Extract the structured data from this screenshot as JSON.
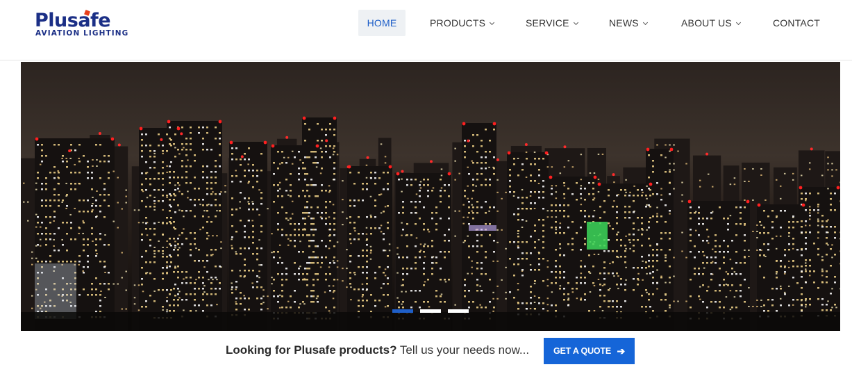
{
  "logo": {
    "name": "Plusafe",
    "tagline": "AVIATION LIGHTING"
  },
  "nav": {
    "items": [
      {
        "label": "HOME",
        "active": true,
        "dropdown": false
      },
      {
        "label": "PRODUCTS",
        "active": false,
        "dropdown": true
      },
      {
        "label": "SERVICE",
        "active": false,
        "dropdown": true
      },
      {
        "label": "NEWS",
        "active": false,
        "dropdown": true
      },
      {
        "label": "ABOUT US",
        "active": false,
        "dropdown": true
      },
      {
        "label": "CONTACT",
        "active": false,
        "dropdown": false
      }
    ]
  },
  "hero": {
    "image_description_icon": "city-night-skyline",
    "slides_count": 3,
    "active_slide": 1
  },
  "cta": {
    "bold": "Looking for Plusafe products?",
    "text": " Tell us your needs now...",
    "button_label": "GET A QUOTE",
    "button_icon": "arrow-right-icon"
  },
  "colors": {
    "brand_blue": "#1b2f86",
    "accent_blue": "#1565d8",
    "logo_dot": "#e8401c"
  }
}
